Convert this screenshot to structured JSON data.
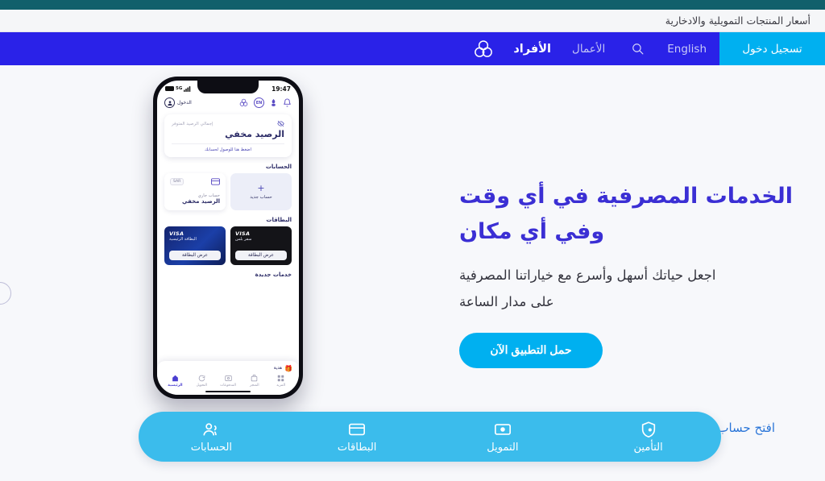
{
  "topbar": {
    "rates_link": "أسعار المنتجات التمويلية والادخارية"
  },
  "nav": {
    "logo_icon": "trefoil-logo-icon",
    "items": [
      {
        "label": "الأفراد",
        "active": true
      },
      {
        "label": "الأعمال",
        "active": false
      }
    ],
    "search_icon": "search-icon",
    "language_label": "English",
    "login_label": "تسجيل دخول"
  },
  "hero": {
    "heading_line1": "الخدمات المصرفية في أي وقت",
    "heading_line2": "وفي أي مكان",
    "sub_line1": "اجعل حياتك أسهل وأسرع مع خياراتنا المصرفية",
    "sub_line2": "على مدار الساعة",
    "cta_label": "حمل التطبيق الآن",
    "secondary_link": "افتح حساب",
    "heading_color": "#3b2fd4",
    "cta_color": "#00b0f0"
  },
  "carousel": {
    "prev_arrow_icon": "chevron-left-icon"
  },
  "phone": {
    "status": {
      "time": "19:47",
      "network": "5G",
      "battery_icon": "battery-icon",
      "signal_icon": "signal-bars-icon"
    },
    "header": {
      "bell_icon": "bell-icon",
      "offers_icon": "offers-icon",
      "lang_pill": "EN",
      "logo_icon": "trefoil-logo-icon",
      "login_label": "الدخول",
      "avatar_icon": "user-avatar-icon"
    },
    "balance": {
      "eye_icon": "eye-off-icon",
      "label": "إجمالي الرصيد المتوفر",
      "amount": "الرصيد مخفي",
      "hint": "اضغط هنا للوصول لحسابك"
    },
    "accounts": {
      "title": "الحسابات",
      "new_account_label": "حساب جديد",
      "new_account_icon": "plus-icon",
      "existing": {
        "card_icon": "card-icon",
        "currency": "SAR",
        "type": "حساب جاري",
        "balance": "الرصيد مخفي"
      }
    },
    "cards": {
      "title": "البطاقات",
      "items": [
        {
          "brand": "VISA",
          "name": "البطاقة الرئيسية",
          "action": "عرض البطاقة",
          "style": "primary"
        },
        {
          "brand": "VISA",
          "name": "سفر بلس",
          "action": "عرض البطاقة",
          "style": "travel"
        }
      ]
    },
    "services": {
      "title": "خدمات جديدة",
      "gift_label": "هدية",
      "gift_icon": "gift-icon"
    },
    "tabbar": [
      {
        "label": "الرئيسية",
        "icon": "home-icon",
        "active": true
      },
      {
        "label": "التحويل",
        "icon": "transfer-icon",
        "active": false
      },
      {
        "label": "المدفوعات",
        "icon": "payments-icon",
        "active": false
      },
      {
        "label": "المتجر",
        "icon": "store-icon",
        "active": false
      },
      {
        "label": "المزيد",
        "icon": "grid-more-icon",
        "active": false
      }
    ]
  },
  "quickbar": {
    "background_color": "#3bbcec",
    "items": [
      {
        "label": "الحسابات",
        "icon": "accounts-icon"
      },
      {
        "label": "البطاقات",
        "icon": "cards-icon"
      },
      {
        "label": "التمويل",
        "icon": "financing-icon"
      },
      {
        "label": "التأمين",
        "icon": "insurance-shield-icon"
      }
    ]
  }
}
